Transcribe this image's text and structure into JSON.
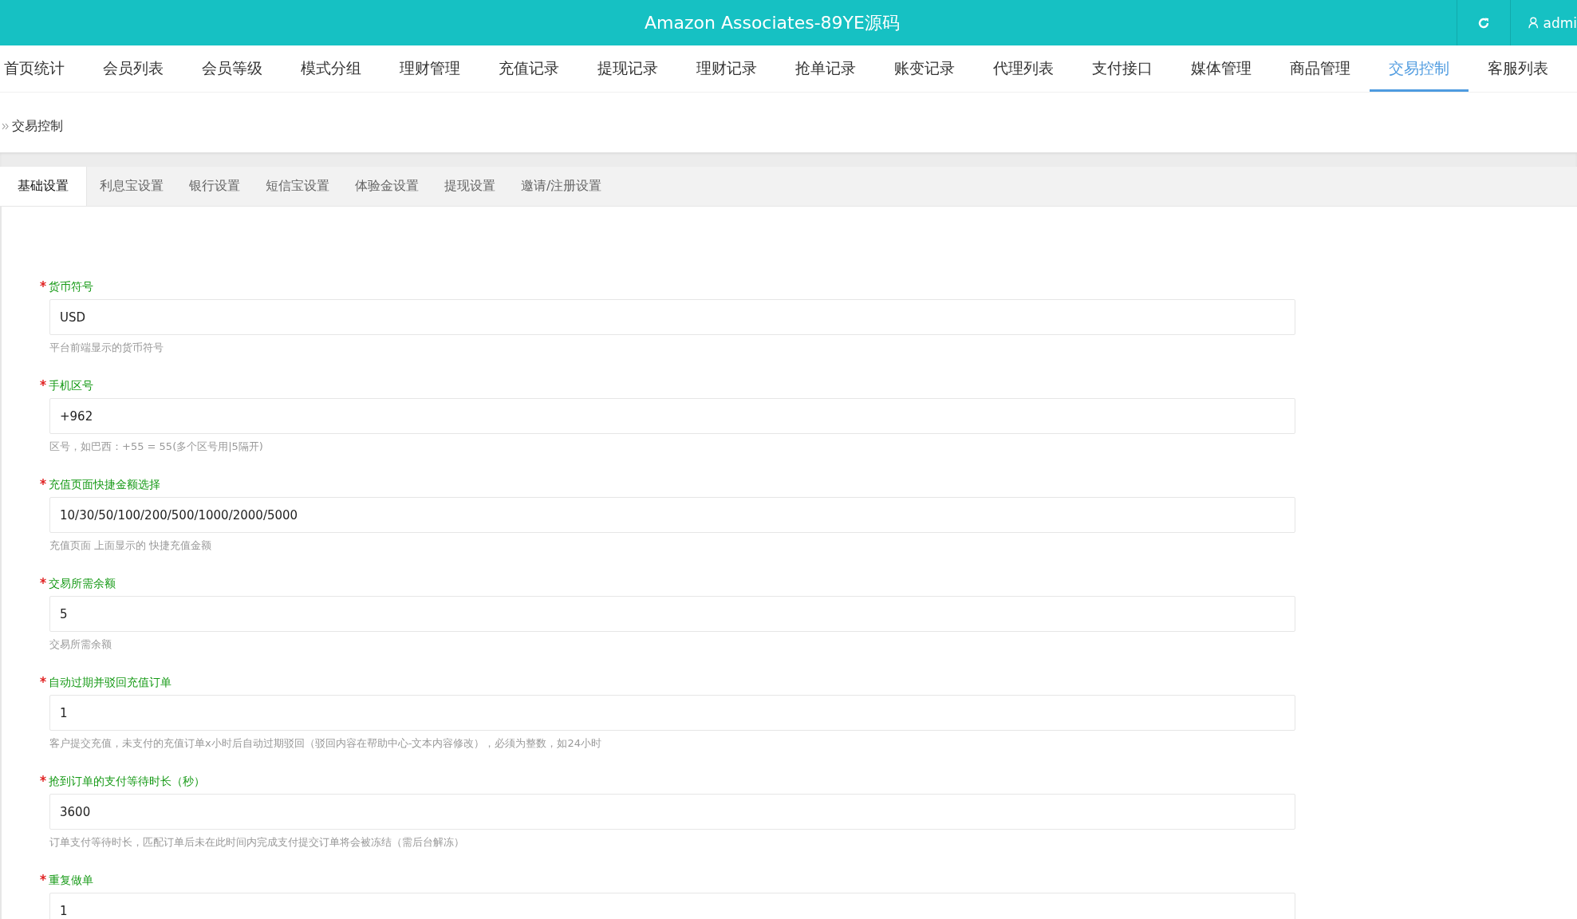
{
  "header": {
    "title": "Amazon Associates-89YE源码",
    "user": "admi"
  },
  "nav": [
    {
      "label": "首页统计",
      "selected": false
    },
    {
      "label": "会员列表",
      "selected": false
    },
    {
      "label": "会员等级",
      "selected": false
    },
    {
      "label": "模式分组",
      "selected": false
    },
    {
      "label": "理财管理",
      "selected": false
    },
    {
      "label": "充值记录",
      "selected": false
    },
    {
      "label": "提现记录",
      "selected": false
    },
    {
      "label": "理财记录",
      "selected": false
    },
    {
      "label": "抢单记录",
      "selected": false
    },
    {
      "label": "账变记录",
      "selected": false
    },
    {
      "label": "代理列表",
      "selected": false
    },
    {
      "label": "支付接口",
      "selected": false
    },
    {
      "label": "媒体管理",
      "selected": false
    },
    {
      "label": "商品管理",
      "selected": false
    },
    {
      "label": "交易控制",
      "selected": true
    },
    {
      "label": "客服列表",
      "selected": false
    }
  ],
  "breadcrumb": "交易控制",
  "tabs": [
    {
      "label": "基础设置",
      "selected": true
    },
    {
      "label": "利息宝设置",
      "selected": false
    },
    {
      "label": "银行设置",
      "selected": false
    },
    {
      "label": "短信宝设置",
      "selected": false
    },
    {
      "label": "体验金设置",
      "selected": false
    },
    {
      "label": "提现设置",
      "selected": false
    },
    {
      "label": "邀请/注册设置",
      "selected": false
    }
  ],
  "fields": [
    {
      "label": "货币符号",
      "required": true,
      "value": "USD",
      "hint": "平台前端显示的货币符号"
    },
    {
      "label": "手机区号",
      "required": true,
      "value": "+962",
      "hint": "区号，如巴西：+55 = 55(多个区号用|5隔开)"
    },
    {
      "label": "充值页面快捷金额选择",
      "required": true,
      "value": "10/30/50/100/200/500/1000/2000/5000",
      "hint": "充值页面 上面显示的 快捷充值金额"
    },
    {
      "label": "交易所需余额",
      "required": true,
      "value": "5",
      "hint": "交易所需余额"
    },
    {
      "label": "自动过期并驳回充值订单",
      "required": true,
      "value": "1",
      "hint": "客户提交充值，未支付的充值订单x小时后自动过期驳回（驳回内容在帮助中心-文本内容修改），必须为整数，如24小时"
    },
    {
      "label": "抢到订单的支付等待时长（秒）",
      "required": true,
      "value": "3600",
      "hint": "订单支付等待时长，匹配订单后未在此时间内完成支付提交订单将会被冻结（需后台解冻）"
    },
    {
      "label": "重复做单",
      "required": true,
      "value": "1"
    }
  ]
}
